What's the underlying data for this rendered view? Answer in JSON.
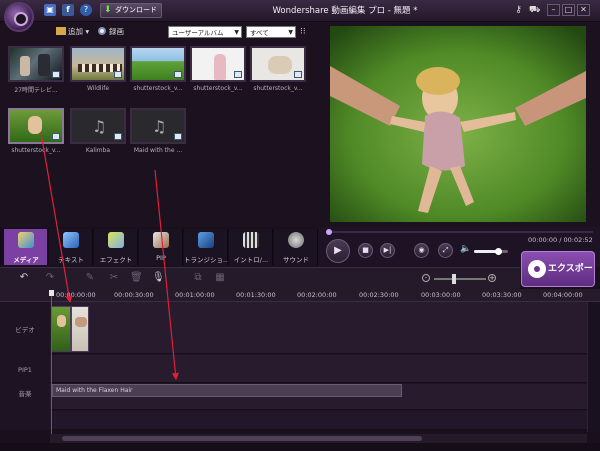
{
  "titlebar": {
    "download_label": "ダウンロード",
    "window_title": "Wondershare 動画編集 プロ - 無題 *"
  },
  "library": {
    "add_label": "追加",
    "record_label": "録画",
    "album_select": "ユーザーアルバム",
    "filter_select": "すべて",
    "items": [
      {
        "name": "27時間テレビ..."
      },
      {
        "name": "Wildlife"
      },
      {
        "name": "shutterstock_v..."
      },
      {
        "name": "shutterstock_v..."
      },
      {
        "name": "shutterstock_v..."
      },
      {
        "name": "shutterstock_v..."
      },
      {
        "name": "Kalimba"
      },
      {
        "name": "Maid with the ..."
      }
    ]
  },
  "player": {
    "timecode": "00:00:00 / 00:02:52",
    "volume": 0.7
  },
  "tabs": [
    {
      "label": "メディア",
      "icon": "media-icon"
    },
    {
      "label": "テキスト",
      "icon": "text-icon"
    },
    {
      "label": "エフェクト",
      "icon": "effect-icon"
    },
    {
      "label": "PIP",
      "icon": "pip-icon"
    },
    {
      "label": "トランジショ...",
      "icon": "transition-icon"
    },
    {
      "label": "イントロ/...",
      "icon": "intro-icon"
    },
    {
      "label": "サウンド",
      "icon": "sound-icon"
    }
  ],
  "export_label": "エクスポート",
  "timeline": {
    "ticks": [
      "00:00:00:00",
      "00:00:30:00",
      "00:01:00:00",
      "00:01:30:00",
      "00:02:00:00",
      "00:02:30:00",
      "00:03:00:00",
      "00:03:30:00",
      "00:04:00:00"
    ],
    "track_video": "ビデオ",
    "track_pip": "PIP1",
    "track_music": "音楽",
    "music_clip": "Maid with the Flaxen Hair"
  },
  "colors": {
    "accent": "#7c3fa2",
    "playhead": "#d42a50",
    "annotation_arrow": "#e0203a"
  }
}
